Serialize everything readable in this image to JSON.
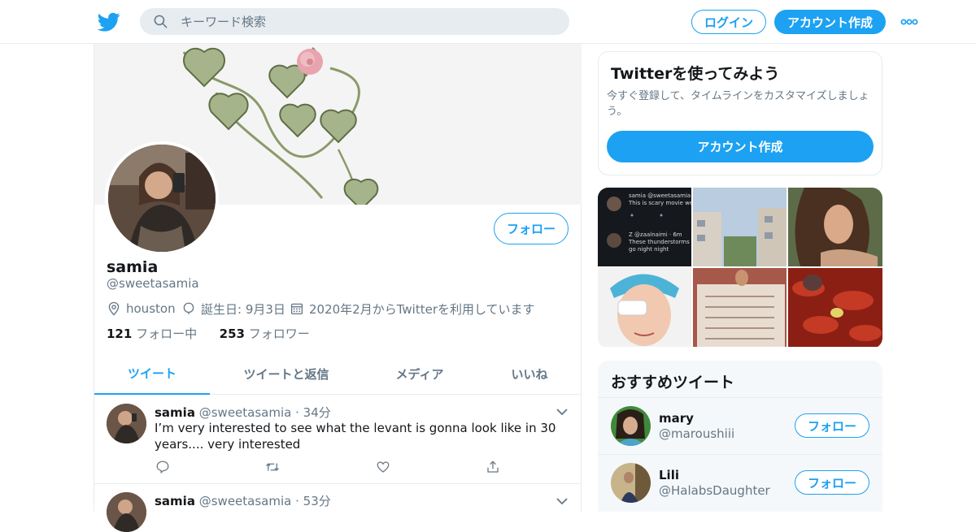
{
  "header": {
    "search_placeholder": "キーワード検索",
    "login_label": "ログイン",
    "signup_label": "アカウント作成"
  },
  "profile": {
    "name": "samia",
    "handle": "@sweetasamia",
    "location": "houston",
    "birthday": "誕生日: 9月3日",
    "joined": "2020年2月からTwitterを利用しています",
    "following_count": "121",
    "following_label": "フォロー中",
    "followers_count": "253",
    "followers_label": "フォロワー",
    "follow_label": "フォロー"
  },
  "tabs": [
    {
      "label": "ツイート",
      "active": true
    },
    {
      "label": "ツイートと返信",
      "active": false
    },
    {
      "label": "メディア",
      "active": false
    },
    {
      "label": "いいね",
      "active": false
    }
  ],
  "tweets": [
    {
      "name": "samia",
      "handle": "@sweetasamia",
      "time": "· 34分",
      "text": "I’m very interested to see what the levant is gonna look like in 30 years.... very interested"
    },
    {
      "name": "samia",
      "handle": "@sweetasamia",
      "time": "· 53分",
      "text": ""
    }
  ],
  "signup_card": {
    "title": "Twitterを使ってみよう",
    "description": "今すぐ登録して、タイムラインをカスタマイズしましょう。",
    "button": "アカウント作成"
  },
  "media_tiles": [
    {
      "lines": [
        "samia @sweetasamia",
        "This is scary movie we",
        "Z @zaalnaimi · 6m",
        "These thunderstorms",
        "go night night"
      ]
    },
    {
      "lines": []
    },
    {
      "lines": []
    },
    {
      "lines": []
    },
    {
      "lines": []
    },
    {
      "lines": []
    }
  ],
  "recommended": {
    "title": "おすすめツイート",
    "users": [
      {
        "name": "mary",
        "handle": "@maroushiii",
        "follow": "フォロー"
      },
      {
        "name": "Lili",
        "handle": "@HalabsDaughter",
        "follow": "フォロー"
      }
    ]
  },
  "colors": {
    "accent": "#1da1f2",
    "text_primary": "#14171a",
    "text_secondary": "#657786",
    "border": "#e6ecf0"
  }
}
